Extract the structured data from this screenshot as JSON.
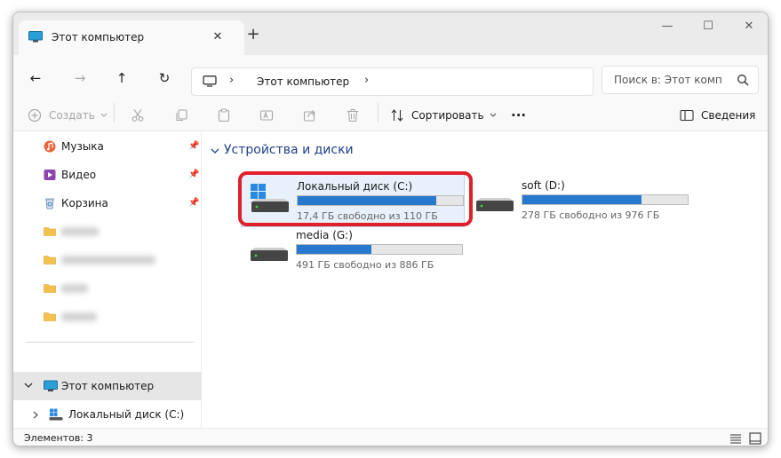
{
  "tab": {
    "title": "Этот компьютер",
    "close": "✕",
    "new_tab": "+"
  },
  "window_controls": {
    "minimize": "—",
    "maximize": "☐",
    "close": "✕"
  },
  "nav": {
    "back": "←",
    "forward": "→",
    "up": "↑",
    "refresh": "↻"
  },
  "address": {
    "separator": "›",
    "location": "Этот компьютер"
  },
  "search": {
    "placeholder": "Поиск в: Этот комп"
  },
  "toolbar": {
    "create_label": "Создать",
    "sort_label": "Сортировать",
    "more_label": "···",
    "details_label": "Сведения"
  },
  "sidebar": {
    "quick_items": [
      {
        "label": "Музыка"
      },
      {
        "label": "Видео"
      },
      {
        "label": "Корзина"
      }
    ],
    "tree": [
      {
        "label": "Этот компьютер"
      },
      {
        "label": "Локальный диск (C:)"
      }
    ]
  },
  "content": {
    "group_title": "Устройства и диски",
    "drives": [
      {
        "name": "Локальный диск (C:)",
        "free": "17,4 ГБ свободно из 110 ГБ",
        "used_fraction": 0.84
      },
      {
        "name": "soft (D:)",
        "free": "278 ГБ свободно из 976 ГБ",
        "used_fraction": 0.72
      },
      {
        "name": "media (G:)",
        "free": "491 ГБ свободно из 886 ГБ",
        "used_fraction": 0.45
      }
    ]
  },
  "status": {
    "items_count": "Элементов: 3"
  },
  "colors": {
    "accent": "#2779d0",
    "highlight": "#e0202a",
    "group_header": "#1e3f8a"
  }
}
